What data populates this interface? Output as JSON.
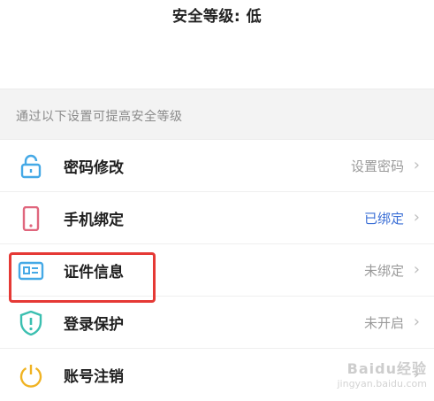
{
  "header": {
    "title": "安全等级: 低"
  },
  "hint": {
    "text": "通过以下设置可提高安全等级"
  },
  "items": [
    {
      "label": "密码修改",
      "status": "设置密码",
      "icon": "lock-icon",
      "color": "#45a9e6"
    },
    {
      "label": "手机绑定",
      "status": "已绑定",
      "icon": "phone-icon",
      "color": "#e0667d",
      "status_color": "#3b6fd6"
    },
    {
      "label": "证件信息",
      "status": "未绑定",
      "icon": "id-card-icon",
      "color": "#45a9e6"
    },
    {
      "label": "登录保护",
      "status": "未开启",
      "icon": "shield-alert-icon",
      "color": "#3bbfb0"
    },
    {
      "label": "账号注销",
      "status": "",
      "icon": "power-icon",
      "color": "#f0b323"
    }
  ],
  "chevron": "›",
  "watermark": {
    "logo": "Baidu经验",
    "url": "jingyan.baidu.com"
  },
  "highlight_color": "#e53935"
}
